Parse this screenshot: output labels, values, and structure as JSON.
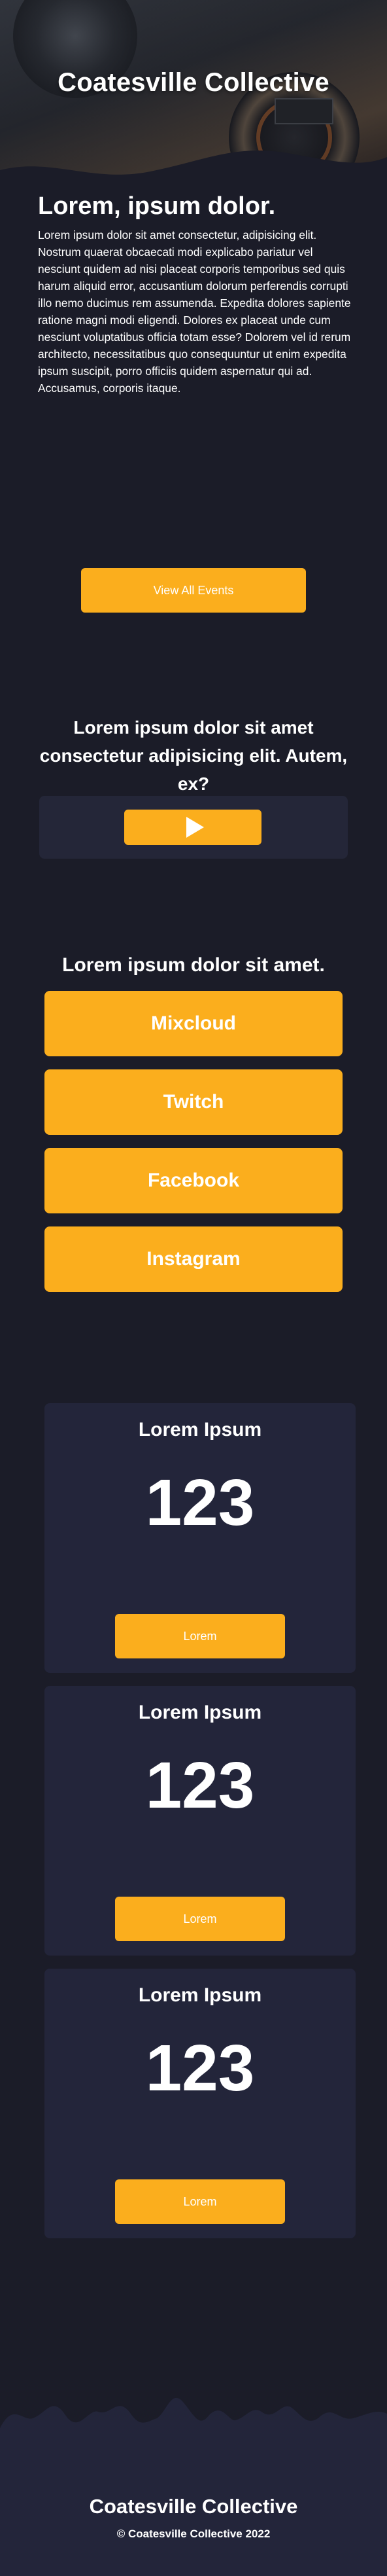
{
  "hero": {
    "title": "Coatesville Collective"
  },
  "intro": {
    "heading": "Lorem, ipsum dolor.",
    "body": "Lorem ipsum dolor sit amet consectetur, adipisicing elit. Nostrum quaerat obcaecati modi explicabo pariatur vel nesciunt quidem ad nisi placeat corporis temporibus sed quis harum aliquid error, accusantium dolorum perferendis corrupti illo nemo ducimus rem assumenda. Expedita dolores sapiente ratione magni modi eligendi. Dolores ex placeat unde cum nesciunt voluptatibus officia totam esse? Dolorem vel id rerum architecto, necessitatibus quo consequuntur ut enim expedita ipsum suscipit, porro officiis quidem aspernatur qui ad. Accusamus, corporis itaque."
  },
  "events": {
    "button_label": "View All Events"
  },
  "video": {
    "title": "Lorem ipsum dolor sit amet consectetur adipisicing elit. Autem, ex?",
    "play_icon": "play-icon"
  },
  "social": {
    "title": "Lorem ipsum dolor sit amet.",
    "links": [
      {
        "label": "Mixcloud"
      },
      {
        "label": "Twitch"
      },
      {
        "label": "Facebook"
      },
      {
        "label": "Instagram"
      }
    ]
  },
  "stats": [
    {
      "title": "Lorem Ipsum",
      "value": "123",
      "button_label": "Lorem"
    },
    {
      "title": "Lorem Ipsum",
      "value": "123",
      "button_label": "Lorem"
    },
    {
      "title": "Lorem Ipsum",
      "value": "123",
      "button_label": "Lorem"
    }
  ],
  "footer": {
    "title": "Coatesville Collective",
    "copyright": "© Coatesville Collective 2022"
  },
  "colors": {
    "background": "#1b1c28",
    "card": "#23253a",
    "accent": "#fbae1d",
    "text": "#ffffff"
  }
}
